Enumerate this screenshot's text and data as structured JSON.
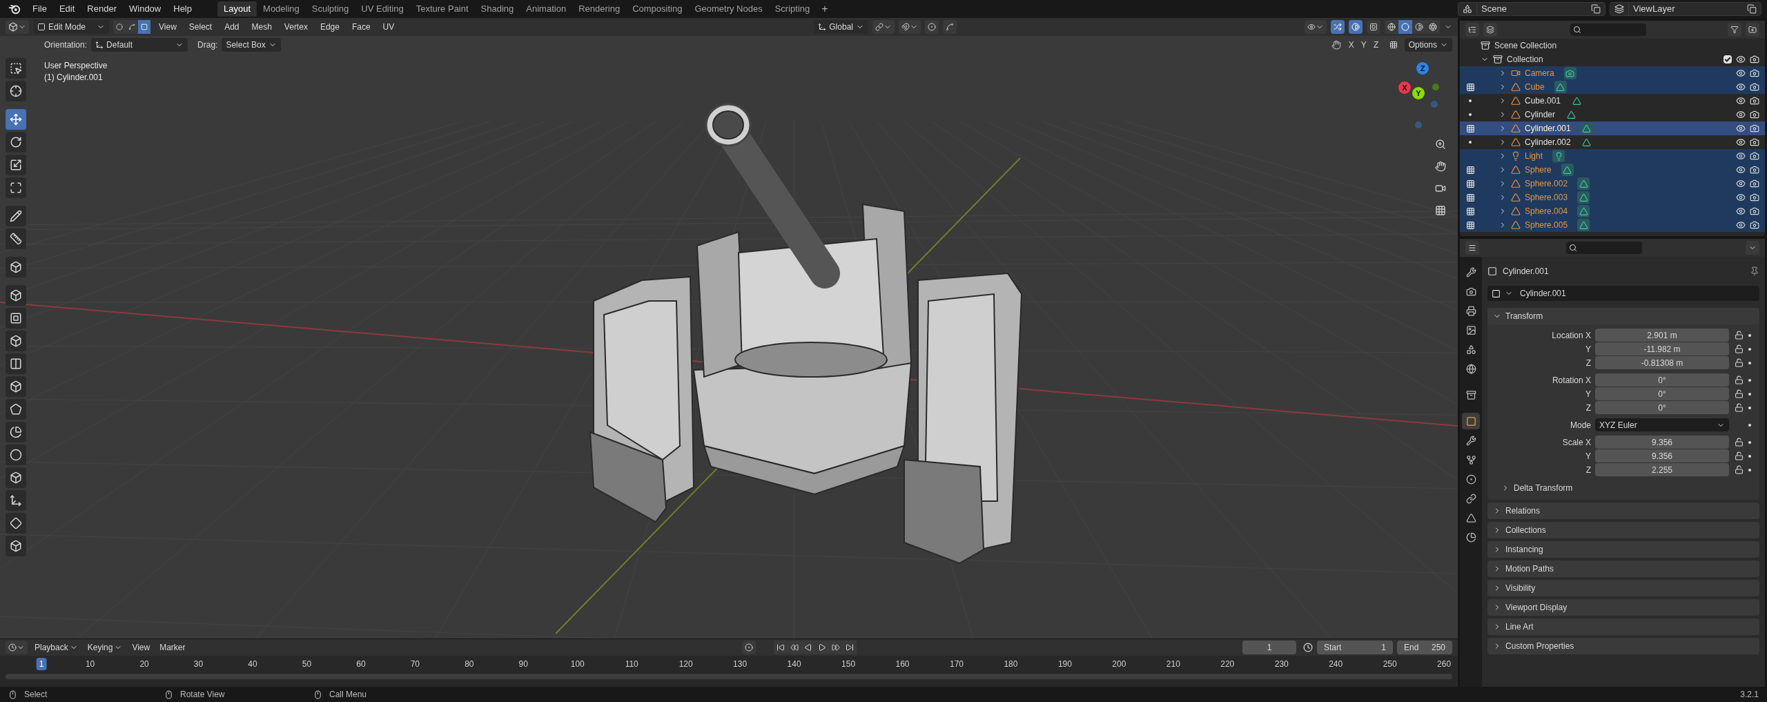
{
  "menu_bar": {
    "menus": [
      "File",
      "Edit",
      "Render",
      "Window",
      "Help"
    ],
    "workspaces": [
      {
        "label": "Layout",
        "selected": true
      },
      {
        "label": "Modeling",
        "selected": false
      },
      {
        "label": "Sculpting",
        "selected": false
      },
      {
        "label": "UV Editing",
        "selected": false
      },
      {
        "label": "Texture Paint",
        "selected": false
      },
      {
        "label": "Shading",
        "selected": false
      },
      {
        "label": "Animation",
        "selected": false
      },
      {
        "label": "Rendering",
        "selected": false
      },
      {
        "label": "Compositing",
        "selected": false
      },
      {
        "label": "Geometry Nodes",
        "selected": false
      },
      {
        "label": "Scripting",
        "selected": false
      }
    ],
    "add_workspace": "+",
    "scene": "Scene",
    "view_layer": "ViewLayer"
  },
  "viewport_header": {
    "mode": "Edit Mode",
    "select_modes": [
      {
        "selected": false
      },
      {
        "selected": false
      },
      {
        "selected": true
      }
    ],
    "menus": [
      "View",
      "Select",
      "Add",
      "Mesh",
      "Vertex",
      "Edge",
      "Face",
      "UV"
    ],
    "orientation": "Global",
    "gizmos_on": true,
    "overlays_on": true,
    "shading": [
      {
        "selected": false
      },
      {
        "selected": true
      },
      {
        "selected": false
      },
      {
        "selected": false
      }
    ]
  },
  "tool_settings": {
    "orientation_label": "Orientation:",
    "orientation": "Default",
    "drag_label": "Drag:",
    "drag": "Select Box",
    "mirror": [
      {
        "label": "X",
        "selected": false
      },
      {
        "label": "Y",
        "selected": false
      },
      {
        "label": "Z",
        "selected": false
      }
    ],
    "options": "Options"
  },
  "viewport": {
    "view_name": "User Perspective",
    "object_info": "(1) Cylinder.001",
    "gizmo_axes": [
      {
        "label": "Z",
        "color": "#2f83e3"
      },
      {
        "label": "X",
        "color": "#e8384f"
      },
      {
        "label": "Y",
        "color": "#8bdc00"
      }
    ]
  },
  "tools": [
    {
      "selected": false
    },
    {
      "selected": false
    },
    {
      "selected": true
    },
    {
      "selected": false
    },
    {
      "selected": false
    },
    {
      "selected": false
    },
    {
      "selected": false
    },
    {
      "selected": false
    },
    {
      "selected": false
    },
    {
      "selected": false
    },
    {
      "selected": false
    },
    {
      "selected": false
    },
    {
      "selected": false
    },
    {
      "selected": false
    },
    {
      "selected": false
    },
    {
      "selected": false
    },
    {
      "selected": false
    },
    {
      "selected": false
    },
    {
      "selected": false
    },
    {
      "selected": false
    },
    {
      "selected": false
    }
  ],
  "outliner": {
    "root": "Scene Collection",
    "collection": {
      "name": "Collection",
      "expanded": true,
      "checked": true,
      "children": [
        {
          "name": "Camera",
          "kind": "camera",
          "selected": true,
          "active": false
        },
        {
          "name": "Cube",
          "kind": "mesh",
          "selected": true,
          "active": false,
          "edit_mode": true
        },
        {
          "name": "Cube.001",
          "kind": "mesh",
          "selected": false,
          "active": false,
          "edit_mode": false
        },
        {
          "name": "Cylinder",
          "kind": "mesh",
          "selected": false,
          "active": false,
          "edit_mode": false
        },
        {
          "name": "Cylinder.001",
          "kind": "mesh",
          "selected": true,
          "active": true,
          "edit_mode": true
        },
        {
          "name": "Cylinder.002",
          "kind": "mesh",
          "selected": false,
          "active": false,
          "edit_mode": false
        },
        {
          "name": "Light",
          "kind": "light",
          "selected": true,
          "active": false
        },
        {
          "name": "Sphere",
          "kind": "mesh",
          "selected": true,
          "active": false,
          "edit_mode": true
        },
        {
          "name": "Sphere.002",
          "kind": "mesh",
          "selected": true,
          "active": false,
          "edit_mode": true
        },
        {
          "name": "Sphere.003",
          "kind": "mesh",
          "selected": true,
          "active": false,
          "edit_mode": true
        },
        {
          "name": "Sphere.004",
          "kind": "mesh",
          "selected": true,
          "active": false,
          "edit_mode": true
        },
        {
          "name": "Sphere.005",
          "kind": "mesh",
          "selected": true,
          "active": false,
          "edit_mode": true
        }
      ]
    }
  },
  "properties": {
    "tabs": [
      {
        "selected": false
      },
      {
        "selected": false
      },
      {
        "selected": false
      },
      {
        "selected": false
      },
      {
        "selected": false
      },
      {
        "selected": false
      },
      {
        "selected": false
      },
      {
        "selected": true
      },
      {
        "selected": false
      },
      {
        "selected": false
      },
      {
        "selected": false
      },
      {
        "selected": false
      },
      {
        "selected": false
      },
      {
        "selected": false
      }
    ],
    "object_title": "Cylinder.001",
    "object_name": "Cylinder.001",
    "transform": {
      "title": "Transform",
      "expanded": true,
      "groups": [
        [
          {
            "kind": "number",
            "label": "Location X",
            "value": "2.901 m"
          },
          {
            "kind": "number",
            "label": "Y",
            "value": "-11.982 m"
          },
          {
            "kind": "number",
            "label": "Z",
            "value": "-0.81308 m"
          }
        ],
        [
          {
            "kind": "number",
            "label": "Rotation X",
            "value": "0°"
          },
          {
            "kind": "number",
            "label": "Y",
            "value": "0°"
          },
          {
            "kind": "number",
            "label": "Z",
            "value": "0°"
          }
        ],
        [
          {
            "kind": "dropdown",
            "label": "Mode",
            "value": "XYZ Euler"
          }
        ],
        [
          {
            "kind": "number",
            "label": "Scale X",
            "value": "9.356"
          },
          {
            "kind": "number",
            "label": "Y",
            "value": "9.356"
          },
          {
            "kind": "number",
            "label": "Z",
            "value": "2.255"
          }
        ]
      ],
      "subpanel": {
        "title": "Delta Transform",
        "expanded": false
      }
    },
    "panels": [
      {
        "title": "Relations",
        "expanded": false
      },
      {
        "title": "Collections",
        "expanded": false
      },
      {
        "title": "Instancing",
        "expanded": false
      },
      {
        "title": "Motion Paths",
        "expanded": false
      },
      {
        "title": "Visibility",
        "expanded": false
      },
      {
        "title": "Viewport Display",
        "expanded": false
      },
      {
        "title": "Line Art",
        "expanded": false
      },
      {
        "title": "Custom Properties",
        "expanded": false
      }
    ]
  },
  "timeline": {
    "menus": [
      {
        "label": "Playback",
        "dropdown": true
      },
      {
        "label": "Keying",
        "dropdown": true
      },
      {
        "label": "View",
        "dropdown": false
      },
      {
        "label": "Marker",
        "dropdown": false
      }
    ],
    "current_frame": "1",
    "start_label": "Start",
    "start": "1",
    "end_label": "End",
    "end": "250",
    "ruler": [
      {
        "label": "1",
        "selected": true
      },
      {
        "label": "10",
        "selected": false
      },
      {
        "label": "20",
        "selected": false
      },
      {
        "label": "30",
        "selected": false
      },
      {
        "label": "40",
        "selected": false
      },
      {
        "label": "50",
        "selected": false
      },
      {
        "label": "60",
        "selected": false
      },
      {
        "label": "70",
        "selected": false
      },
      {
        "label": "80",
        "selected": false
      },
      {
        "label": "90",
        "selected": false
      },
      {
        "label": "100",
        "selected": false
      },
      {
        "label": "110",
        "selected": false
      },
      {
        "label": "120",
        "selected": false
      },
      {
        "label": "130",
        "selected": false
      },
      {
        "label": "140",
        "selected": false
      },
      {
        "label": "150",
        "selected": false
      },
      {
        "label": "160",
        "selected": false
      },
      {
        "label": "170",
        "selected": false
      },
      {
        "label": "180",
        "selected": false
      },
      {
        "label": "190",
        "selected": false
      },
      {
        "label": "200",
        "selected": false
      },
      {
        "label": "210",
        "selected": false
      },
      {
        "label": "220",
        "selected": false
      },
      {
        "label": "230",
        "selected": false
      },
      {
        "label": "240",
        "selected": false
      },
      {
        "label": "250",
        "selected": false
      },
      {
        "label": "260",
        "selected": false
      }
    ]
  },
  "status_bar": {
    "hints": [
      "Select",
      "Rotate View",
      "Call Menu"
    ],
    "version": "3.2.1"
  }
}
